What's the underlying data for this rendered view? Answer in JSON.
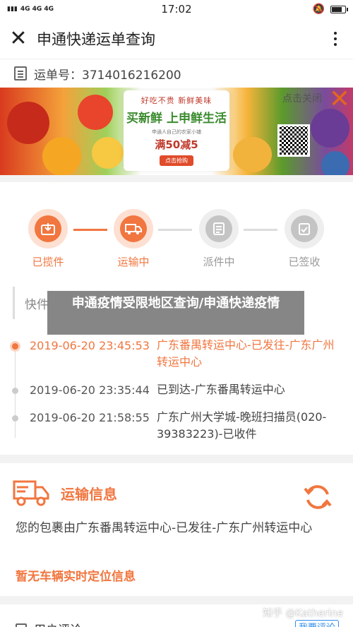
{
  "status_bar": {
    "network_left": "4G 4G 4G",
    "time": "17:02",
    "battery_level": 0.75
  },
  "app_bar": {
    "title": "申通快递运单查询",
    "close_icon": "close-icon",
    "more_icon": "more-vertical-icon"
  },
  "waybill": {
    "label": "运单号：3714016216200"
  },
  "banner": {
    "slogan": "好吃不贵  新鲜美味",
    "headline": "买新鲜 上申鲜生活",
    "subline": "申通人自己的农家小铺",
    "promo": "满50减5",
    "cta": "点击抢购",
    "close_text": "点击关闭"
  },
  "steps": [
    {
      "label": "已揽件",
      "state": "done",
      "icon": "package-icon"
    },
    {
      "label": "运输中",
      "state": "current",
      "icon": "truck-icon"
    },
    {
      "label": "派件中",
      "state": "pending",
      "icon": "delivery-list-icon"
    },
    {
      "label": "已签收",
      "state": "pending",
      "icon": "signed-clipboard-icon"
    }
  ],
  "tracking": {
    "section_label": "快件",
    "rows": [
      {
        "time": "2019-06-20 23:45:53",
        "desc": "广东番禺转运中心-已发往-广东广州转运中心",
        "current": true
      },
      {
        "time": "2019-06-20 23:35:44",
        "desc": "已到达-广东番禺转运中心",
        "current": false
      },
      {
        "time": "2019-06-20 21:58:55",
        "desc": "广东广州大学城-晚班扫描员(020-39383223)-已收件",
        "current": false
      }
    ]
  },
  "overlay_caption": "申通疫情受限地区查询/申通快递疫情",
  "transport": {
    "title": "运输信息",
    "message": "您的包裹由广东番禺转运中心-已发往-广东广州转运中心",
    "no_vehicle": "暂无车辆实时定位信息"
  },
  "review": {
    "title": "用户评论",
    "button": "我要评论"
  },
  "watermark": "知乎 @Katherine",
  "colors": {
    "accent": "#f1763f",
    "accent_light": "#fde0d2",
    "inactive": "#c4c4c4"
  }
}
